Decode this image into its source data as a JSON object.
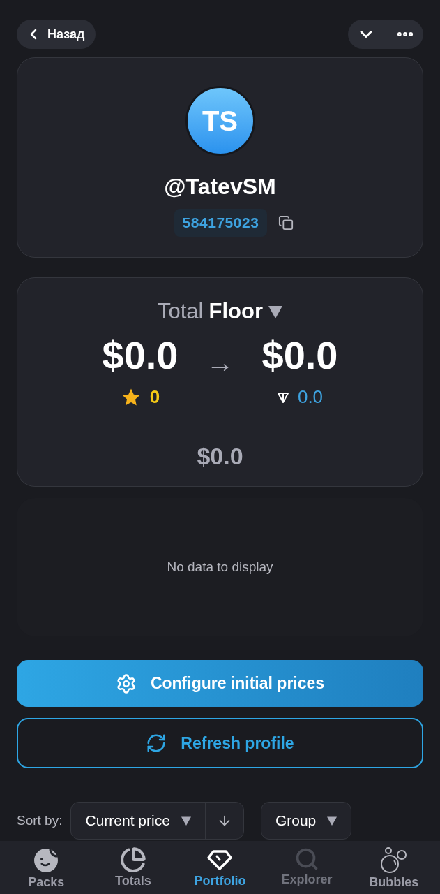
{
  "header": {
    "back_label": "Назад"
  },
  "profile": {
    "initials": "TS",
    "username": "@TatevSM",
    "user_id": "584175023"
  },
  "totals": {
    "prefix": "Total",
    "mode": "Floor",
    "from_value": "$0.0",
    "to_value": "$0.0",
    "stars": "0",
    "ton": "0.0",
    "arrow": "→",
    "difference": "$0.0"
  },
  "chart": {
    "empty_message": "No data to display"
  },
  "actions": [
    {
      "kind": "primary",
      "label": "Configure initial prices"
    },
    {
      "kind": "outline",
      "label": "Refresh profile"
    }
  ],
  "sort": {
    "label": "Sort by:",
    "field": "Current price",
    "group": "Group"
  },
  "nav": [
    {
      "label": "Packs",
      "selected": false,
      "disabled": false
    },
    {
      "label": "Totals",
      "selected": false,
      "disabled": false
    },
    {
      "label": "Portfolio",
      "selected": true,
      "disabled": false
    },
    {
      "label": "Explorer",
      "selected": false,
      "disabled": true
    },
    {
      "label": "Bubbles",
      "selected": false,
      "disabled": false
    }
  ]
}
